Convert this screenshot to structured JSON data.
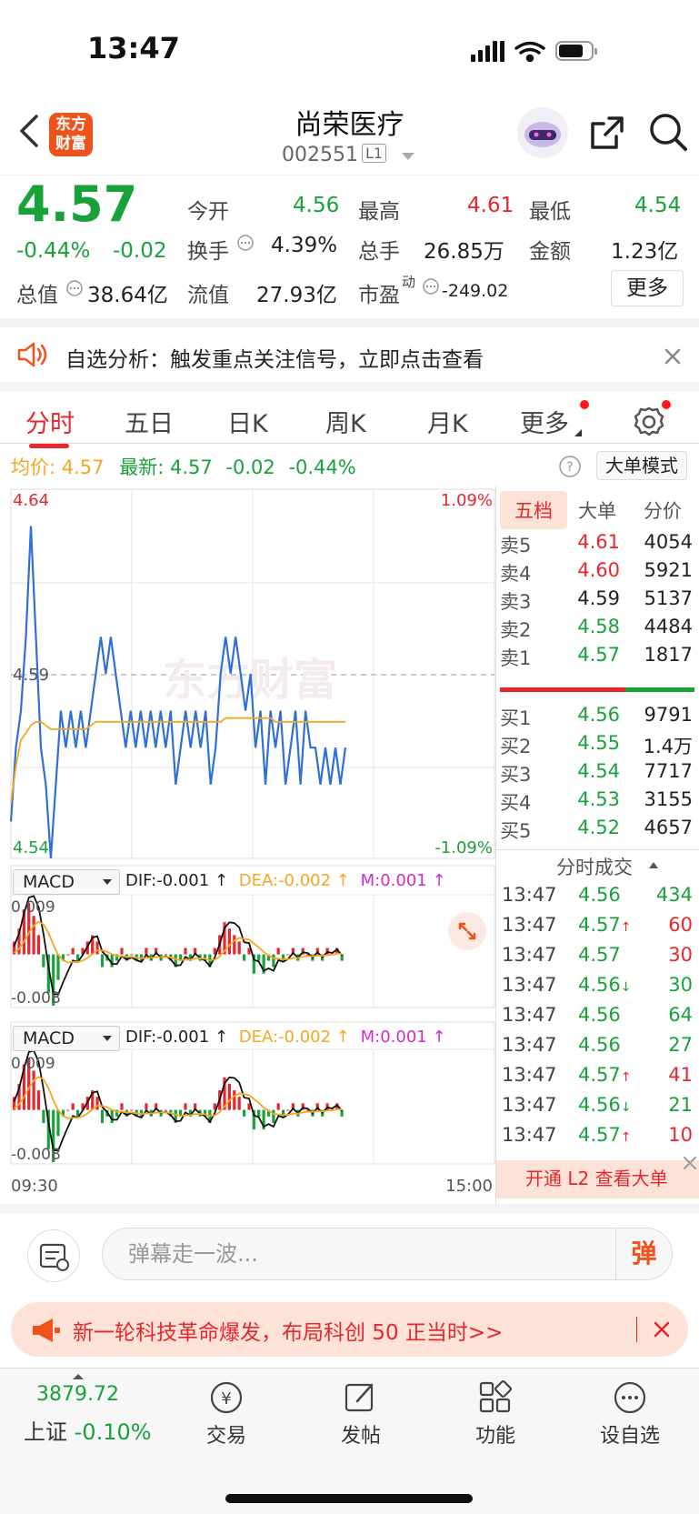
{
  "status_bar": {
    "time": "13:47"
  },
  "header": {
    "logo_text": "东方财富",
    "stock_name": "尚荣医疗",
    "stock_code": "002551",
    "level_badge": "L1"
  },
  "quote": {
    "price": "4.57",
    "change_pct": "-0.44%",
    "change": "-0.02",
    "fields": {
      "open_label": "今开",
      "open": "4.56",
      "high_label": "最高",
      "high": "4.61",
      "low_label": "最低",
      "low": "4.54",
      "turnover_label": "换手",
      "turnover": "4.39%",
      "volume_label": "总手",
      "volume": "26.85万",
      "amount_label": "金额",
      "amount": "1.23亿",
      "mcap_label": "总值",
      "mcap": "38.64亿",
      "float_label": "流值",
      "float": "27.93亿",
      "pe_label": "市盈",
      "pe_sup": "动",
      "pe": "-249.02"
    },
    "more_label": "更多"
  },
  "banner": {
    "text": "自选分析：触发重点关注信号，立即点击查看"
  },
  "tabs": [
    "分时",
    "五日",
    "日K",
    "周K",
    "月K",
    "更多"
  ],
  "info_row": {
    "avg_label": "均价:",
    "avg": "4.57",
    "latest_label": "最新:",
    "latest": "4.57",
    "latest_change": "-0.02",
    "latest_pct": "-0.44%",
    "mode_button": "大单模式"
  },
  "chart_data": [
    {
      "type": "line",
      "y_top": "4.64",
      "y_mid": "4.59",
      "y_bottom": "4.54",
      "pct_top": "1.09%",
      "pct_bottom": "-1.09%",
      "watermark": "东方财富",
      "x_start": "09:30",
      "x_end": "15:00",
      "ylim": [
        4.54,
        4.64
      ],
      "series": [
        {
          "color": "#2f6fd6",
          "values": [
            4.55,
            4.57,
            4.58,
            4.6,
            4.63,
            4.6,
            4.57,
            4.56,
            4.54,
            4.56,
            4.58,
            4.57,
            4.58,
            4.57,
            4.58,
            4.57,
            4.58,
            4.59,
            4.6,
            4.59,
            4.6,
            4.59,
            4.58,
            4.57,
            4.58,
            4.57,
            4.58,
            4.57,
            4.58,
            4.57,
            4.58,
            4.57,
            4.58,
            4.56,
            4.57,
            4.58,
            4.57,
            4.58,
            4.57,
            4.58,
            4.56,
            4.57,
            4.59,
            4.6,
            4.59,
            4.6,
            4.59,
            4.58,
            4.59,
            4.57,
            4.58,
            4.56,
            4.58,
            4.57,
            4.58,
            4.56,
            4.57,
            4.58,
            4.56,
            4.58,
            4.57,
            4.57,
            4.56,
            4.57,
            4.56,
            4.57,
            4.56,
            4.57
          ]
        },
        {
          "color": "#f5a623",
          "values": [
            4.555,
            4.565,
            4.572,
            4.574,
            4.576,
            4.577,
            4.577,
            4.576,
            4.575,
            4.575,
            4.575,
            4.575,
            4.575,
            4.575,
            4.575,
            4.575,
            4.576,
            4.577,
            4.577,
            4.577,
            4.577,
            4.577,
            4.577,
            4.577,
            4.577,
            4.577,
            4.577,
            4.577,
            4.577,
            4.577,
            4.577,
            4.577,
            4.577,
            4.577,
            4.577,
            4.577,
            4.577,
            4.577,
            4.577,
            4.577,
            4.577,
            4.577,
            4.577,
            4.578,
            4.578,
            4.578,
            4.578,
            4.578,
            4.578,
            4.578,
            4.578,
            4.578,
            4.578,
            4.577,
            4.577,
            4.577,
            4.577,
            4.577,
            4.577,
            4.577,
            4.577,
            4.577,
            4.577,
            4.577,
            4.577,
            4.577,
            4.577,
            4.577
          ]
        }
      ]
    },
    {
      "type": "bar",
      "indicator": "MACD",
      "dif_label": "DIF:-0.001",
      "dea_label": "DEA:-0.002",
      "m_label": "M:0.001",
      "y_top": "0.009",
      "y_bottom": "-0.008",
      "ylim": [
        -0.008,
        0.009
      ],
      "values": [
        0.002,
        0.004,
        0.007,
        0.008,
        0.006,
        0.003,
        -0.002,
        -0.006,
        -0.008,
        -0.004,
        -0.001,
        0.0,
        0.001,
        -0.001,
        0.001,
        0.002,
        0.003,
        0.002,
        -0.002,
        -0.001,
        -0.002,
        -0.001,
        0.001,
        -0.001,
        0.0,
        -0.001,
        -0.001,
        0.001,
        -0.001,
        0.001,
        -0.001,
        0.0,
        -0.001,
        -0.002,
        -0.001,
        0.001,
        -0.001,
        0.001,
        -0.001,
        -0.001,
        -0.002,
        0.001,
        0.003,
        0.005,
        0.004,
        0.003,
        0.002,
        -0.001,
        0.001,
        -0.003,
        -0.001,
        -0.003,
        -0.001,
        -0.002,
        0.001,
        -0.001,
        0.0,
        0.001,
        -0.001,
        0.001,
        0.0,
        -0.001,
        0.001,
        -0.001,
        0.001,
        0.0,
        0.001,
        -0.001
      ]
    },
    {
      "type": "bar",
      "indicator": "MACD",
      "dif_label": "DIF:-0.001",
      "dea_label": "DEA:-0.002",
      "m_label": "M:0.001",
      "y_top": "0.009",
      "y_bottom": "-0.008",
      "ylim": [
        -0.008,
        0.009
      ],
      "values": [
        0.002,
        0.004,
        0.007,
        0.008,
        0.006,
        0.003,
        -0.002,
        -0.006,
        -0.008,
        -0.004,
        -0.001,
        0.0,
        0.001,
        -0.001,
        0.001,
        0.002,
        0.003,
        0.002,
        -0.002,
        -0.001,
        -0.002,
        -0.001,
        0.001,
        -0.001,
        0.0,
        -0.001,
        -0.001,
        0.001,
        -0.001,
        0.001,
        -0.001,
        0.0,
        -0.001,
        -0.002,
        -0.001,
        0.001,
        -0.001,
        0.001,
        -0.001,
        -0.001,
        -0.002,
        0.001,
        0.003,
        0.005,
        0.004,
        0.003,
        0.002,
        -0.001,
        0.001,
        -0.003,
        -0.001,
        -0.003,
        -0.001,
        -0.002,
        0.001,
        -0.001,
        0.0,
        0.001,
        -0.001,
        0.001,
        0.0,
        -0.001,
        0.001,
        -0.001,
        0.001,
        0.0,
        0.001,
        -0.001
      ]
    }
  ],
  "order_book": {
    "tabs": [
      "五档",
      "大单",
      "分价"
    ],
    "asks": [
      {
        "label": "卖5",
        "price": "4.61",
        "vol": "4054",
        "color": "red"
      },
      {
        "label": "卖4",
        "price": "4.60",
        "vol": "5921",
        "color": "red"
      },
      {
        "label": "卖3",
        "price": "4.59",
        "vol": "5137",
        "color": "black"
      },
      {
        "label": "卖2",
        "price": "4.58",
        "vol": "4484",
        "color": "green"
      },
      {
        "label": "卖1",
        "price": "4.57",
        "vol": "1817",
        "color": "green"
      }
    ],
    "bids": [
      {
        "label": "买1",
        "price": "4.56",
        "vol": "9791",
        "color": "green"
      },
      {
        "label": "买2",
        "price": "4.55",
        "vol": "1.4万",
        "color": "green"
      },
      {
        "label": "买3",
        "price": "4.54",
        "vol": "7717",
        "color": "green"
      },
      {
        "label": "买4",
        "price": "4.53",
        "vol": "3155",
        "color": "green"
      },
      {
        "label": "买5",
        "price": "4.52",
        "vol": "4657",
        "color": "green"
      }
    ],
    "trades_title": "分时成交",
    "trades": [
      {
        "time": "13:47",
        "price": "4.56",
        "dir": "",
        "vol": "434",
        "color": "green"
      },
      {
        "time": "13:47",
        "price": "4.57",
        "dir": "↑",
        "vol": "60",
        "color": "red"
      },
      {
        "time": "13:47",
        "price": "4.57",
        "dir": "",
        "vol": "30",
        "color": "red"
      },
      {
        "time": "13:47",
        "price": "4.56",
        "dir": "↓",
        "vol": "30",
        "color": "green"
      },
      {
        "time": "13:47",
        "price": "4.56",
        "dir": "",
        "vol": "64",
        "color": "green"
      },
      {
        "time": "13:47",
        "price": "4.56",
        "dir": "",
        "vol": "27",
        "color": "green"
      },
      {
        "time": "13:47",
        "price": "4.57",
        "dir": "↑",
        "vol": "41",
        "color": "red"
      },
      {
        "time": "13:47",
        "price": "4.56",
        "dir": "↓",
        "vol": "21",
        "color": "green"
      },
      {
        "time": "13:47",
        "price": "4.57",
        "dir": "↑",
        "vol": "10",
        "color": "red"
      }
    ],
    "l2_text": "开通 L2 查看大单"
  },
  "danmu": {
    "placeholder": "弹幕走一波...",
    "send_label": "弹"
  },
  "ad": {
    "text": "新一轮科技革命爆发，布局科创 50 正当时>>"
  },
  "bottom_nav": {
    "index_value": "3879.72",
    "index_name": "上证",
    "index_change": "-0.10%",
    "items": [
      "交易",
      "发帖",
      "功能",
      "设自选"
    ]
  }
}
